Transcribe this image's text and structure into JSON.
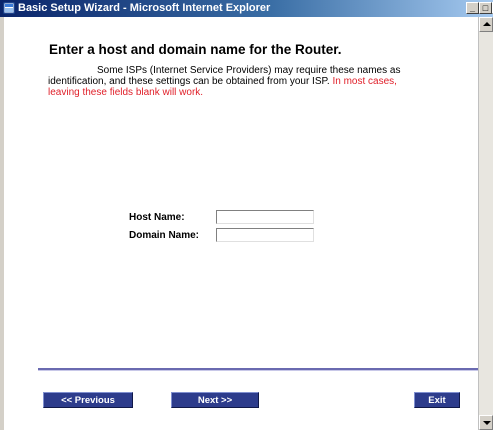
{
  "window": {
    "title": "Basic Setup Wizard - Microsoft Internet Explorer",
    "controls": {
      "minimize": "_",
      "maximize": "□",
      "close": "×"
    }
  },
  "page": {
    "heading": "Enter a host and domain name for the Router.",
    "description": "Some ISPs (Internet Service Providers) may require these names as identification, and these settings can be obtained from your ISP.",
    "note": "In most cases, leaving these fields blank will work.",
    "note_color": "#e0202a"
  },
  "form": {
    "host_label": "Host Name:",
    "host_value": "",
    "domain_label": "Domain Name:",
    "domain_value": ""
  },
  "nav": {
    "previous": "<< Previous",
    "next": "Next >>",
    "exit": "Exit",
    "button_color": "#2d3c8c"
  },
  "icons": [
    "ie-page-icon",
    "scroll-up-arrow-icon",
    "scroll-down-arrow-icon"
  ]
}
